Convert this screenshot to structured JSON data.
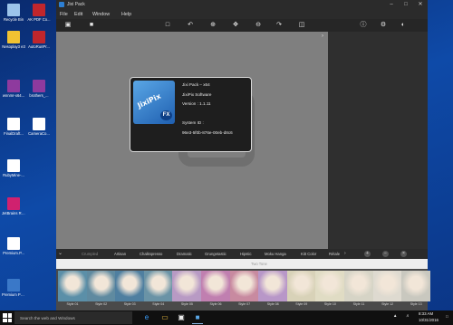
{
  "desktop": {
    "icons": [
      {
        "label": "Recycle Bin",
        "color": "#9cc4ea"
      },
      {
        "label": "AK PDF Co...",
        "color": "#c0262c"
      },
      {
        "label": "Nesoplay3 e3",
        "color": "#f1c232"
      },
      {
        "label": "AutoRunPr...",
        "color": "#c0262c"
      },
      {
        "label": "wnnmr-x64...",
        "color": "#8e3a9e"
      },
      {
        "label": "brothers_...",
        "color": "#8e3a9e"
      },
      {
        "label": "FinalDraft...",
        "color": "#ffffff"
      },
      {
        "label": "CameraCo...",
        "color": "#ffffff"
      },
      {
        "label": "RubyMine-...",
        "color": "#ffffff"
      },
      {
        "label": "JetBrains RubyMin...",
        "color": "#d0216f"
      },
      {
        "label": "Premium.P...",
        "color": "#ffffff"
      },
      {
        "label": "Premium Pack",
        "color": "#3a78c8"
      }
    ]
  },
  "app": {
    "title": "Jixi Pack",
    "menu": [
      "File",
      "Edit",
      "Window",
      "Help"
    ],
    "about": {
      "product": "Jixi Pack – x64",
      "company": "JixiPix Software",
      "version": "Version : 1.1.11",
      "system_id_label": "System ID :",
      "system_id": "96e3-5f0b-876e-00eb-d8c6",
      "logo_word": "JixiPix",
      "logo_badge": "FX"
    },
    "tabs": [
      "Crumpled",
      "Artisan",
      "Chalkspresso",
      "Dramatic",
      "Grungetastic",
      "Hipstic",
      "Moku Hanga",
      "Kitt Color",
      "Rétale"
    ],
    "subheader": "Two Tone",
    "thumbs": [
      {
        "caption": "Style 01",
        "color": "#5b8fa8"
      },
      {
        "caption": "Style 02",
        "color": "#5f8aa0"
      },
      {
        "caption": "Style 03",
        "color": "#4f7fa0"
      },
      {
        "caption": "Style 04",
        "color": "#6a93a6"
      },
      {
        "caption": "Style 05",
        "color": "#b89ac4"
      },
      {
        "caption": "Style 06",
        "color": "#c07fb0"
      },
      {
        "caption": "Style 07",
        "color": "#c88aa0"
      },
      {
        "caption": "Style 08",
        "color": "#b897c8"
      },
      {
        "caption": "Style 09",
        "color": "#d8d2b8"
      },
      {
        "caption": "Style 10",
        "color": "#e0dcc4"
      },
      {
        "caption": "Style 11",
        "color": "#d6d4c6"
      },
      {
        "caption": "Style 12",
        "color": "#dedad0"
      },
      {
        "caption": "Style 13",
        "color": "#c9c8bf"
      }
    ]
  },
  "taskbar": {
    "search_placeholder": "Search the web and Windows",
    "time": "8:33 AM",
    "date": "10/31/2016"
  }
}
